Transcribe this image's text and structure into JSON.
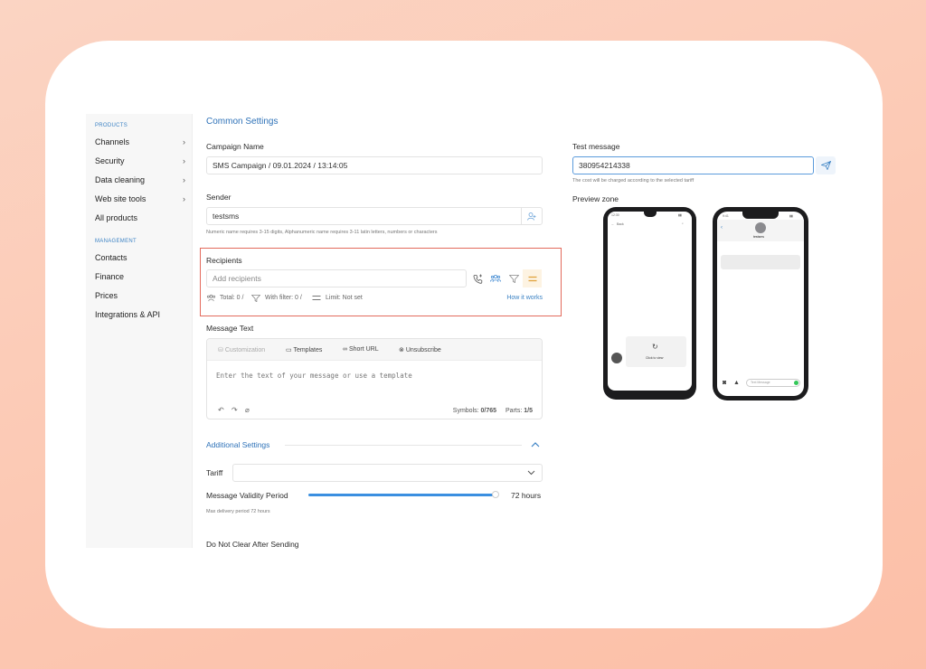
{
  "sidebar": {
    "products_label": "PRODUCTS",
    "management_label": "MANAGEMENT",
    "products": [
      {
        "label": "Channels"
      },
      {
        "label": "Security"
      },
      {
        "label": "Data cleaning"
      },
      {
        "label": "Web site tools"
      },
      {
        "label": "All products"
      }
    ],
    "management": [
      {
        "label": "Contacts"
      },
      {
        "label": "Finance"
      },
      {
        "label": "Prices"
      },
      {
        "label": "Integrations & API"
      }
    ]
  },
  "common": {
    "title": "Common Settings",
    "campaign_label": "Campaign Name",
    "campaign_value": "SMS Campaign / 09.01.2024 / 13:14:05",
    "sender_label": "Sender",
    "sender_value": "testsms",
    "sender_hint": "Numeric name requires 3-15 digits, Alphanumeric name requires 3-11 latin letters, numbers or characters"
  },
  "recipients": {
    "label": "Recipients",
    "placeholder": "Add recipients",
    "total": "Total: 0 /",
    "with_filter": "With filter: 0 /",
    "limit": "Limit: Not set",
    "how_it_works": "How it works"
  },
  "message": {
    "label": "Message Text",
    "toolbar": {
      "customization": "Customization",
      "templates": "Templates",
      "short_url": "Short URL",
      "unsubscribe": "Unsubscribe"
    },
    "placeholder": "Enter the text of your message or use a template",
    "symbols_label": "Symbols:",
    "symbols_value": "0/765",
    "parts_label": "Parts:",
    "parts_value": "1/5"
  },
  "additional": {
    "title": "Additional Settings",
    "tariff_label": "Tariff",
    "tariff_value": "",
    "validity_label": "Message Validity Period",
    "validity_value": "72 hours",
    "validity_fill": 0.99,
    "validity_hint": "Max delivery period 72 hours",
    "no_clear_label": "Do Not Clear After Sending"
  },
  "test": {
    "label": "Test message",
    "value": "380954214338",
    "hint": "The cost will be charged according to the selected tariff",
    "preview_label": "Preview zone"
  },
  "phones": {
    "android": {
      "time": "12:30",
      "back": "Back",
      "click_to_view": "Click to view"
    },
    "iphone": {
      "time": "9:41",
      "contact": "testsms",
      "input_placeholder": "Text Message"
    }
  },
  "colors": {
    "accent": "#2e72b8",
    "highlight": "#e36a5c",
    "background": "#fcc9b4"
  }
}
